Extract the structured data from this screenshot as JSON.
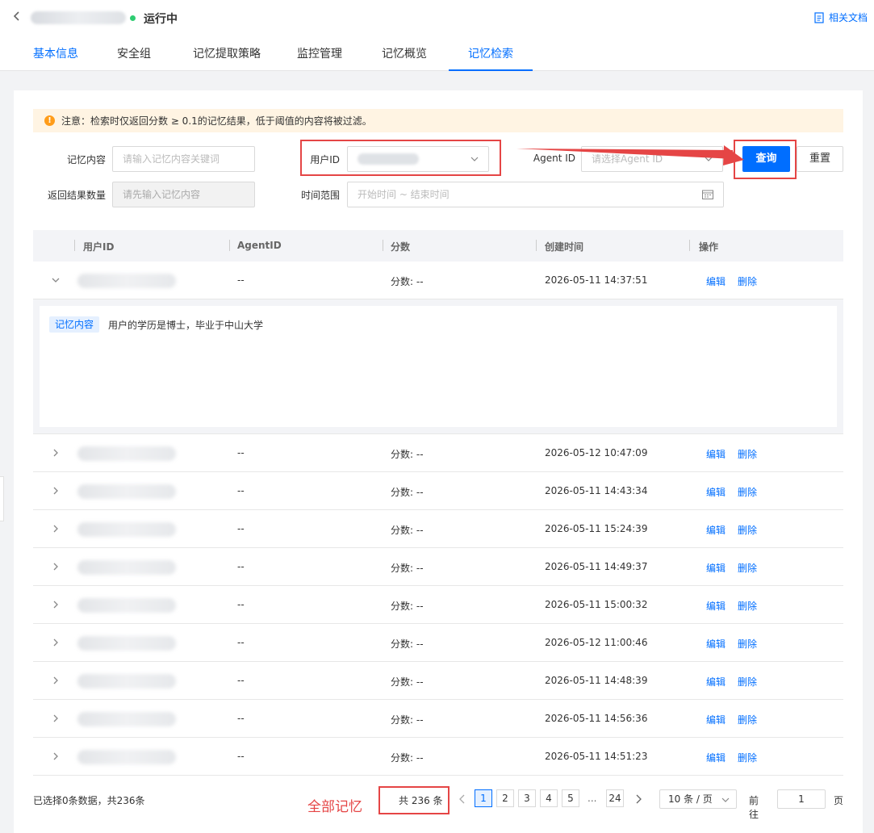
{
  "header": {
    "status": "运行中",
    "doc_link": "相关文档",
    "status_color": "#2ecc71"
  },
  "tabs": [
    {
      "label": "基本信息"
    },
    {
      "label": "安全组"
    },
    {
      "label": "记忆提取策略"
    },
    {
      "label": "监控管理"
    },
    {
      "label": "记忆概览"
    },
    {
      "label": "记忆检索"
    }
  ],
  "notice": {
    "text": "注意：检索时仅返回分数 ≥ 0.1的记忆结果，低于阈值的内容将被过滤。"
  },
  "form": {
    "memory_content_label": "记忆内容",
    "memory_content_placeholder": "请输入记忆内容关键词",
    "user_id_label": "用户ID",
    "agent_id_label": "Agent ID",
    "agent_id_placeholder": "请选择Agent ID",
    "result_count_label": "返回结果数量",
    "result_count_placeholder": "请先输入记忆内容",
    "time_range_label": "时间范围",
    "time_range_placeholder": "开始时间 ~ 结束时间",
    "search_button": "查询",
    "reset_button": "重置"
  },
  "table": {
    "columns": [
      "用户ID",
      "AgentID",
      "分数",
      "创建时间",
      "操作"
    ],
    "expanded_tag": "记忆内容",
    "expanded_text": "用户的学历是博士，毕业于中山大学",
    "edit_label": "编辑",
    "delete_label": "删除",
    "rows": [
      {
        "agent": "--",
        "score": "分数: --",
        "time": "2026-05-11 14:37:51"
      },
      {
        "agent": "--",
        "score": "分数: --",
        "time": "2026-05-12 10:47:09"
      },
      {
        "agent": "--",
        "score": "分数: --",
        "time": "2026-05-11 14:43:34"
      },
      {
        "agent": "--",
        "score": "分数: --",
        "time": "2026-05-11 15:24:39"
      },
      {
        "agent": "--",
        "score": "分数: --",
        "time": "2026-05-11 14:49:37"
      },
      {
        "agent": "--",
        "score": "分数: --",
        "time": "2026-05-11 15:00:32"
      },
      {
        "agent": "--",
        "score": "分数: --",
        "time": "2026-05-12 11:00:46"
      },
      {
        "agent": "--",
        "score": "分数: --",
        "time": "2026-05-11 14:48:39"
      },
      {
        "agent": "--",
        "score": "分数: --",
        "time": "2026-05-11 14:56:36"
      },
      {
        "agent": "--",
        "score": "分数: --",
        "time": "2026-05-11 14:51:23"
      }
    ]
  },
  "footer": {
    "selection_text": "已选择0条数据，共236条",
    "annotation": "全部记忆",
    "total": "共 236 条",
    "pages": [
      "1",
      "2",
      "3",
      "4",
      "5",
      "...",
      "24"
    ],
    "page_size": "10 条 / 页",
    "goto_label": "前往",
    "goto_value": "1",
    "page_unit": "页"
  },
  "colors": {
    "accent": "#006eff",
    "annotation_red": "#e54545",
    "notice_bg": "#fff4e3"
  }
}
